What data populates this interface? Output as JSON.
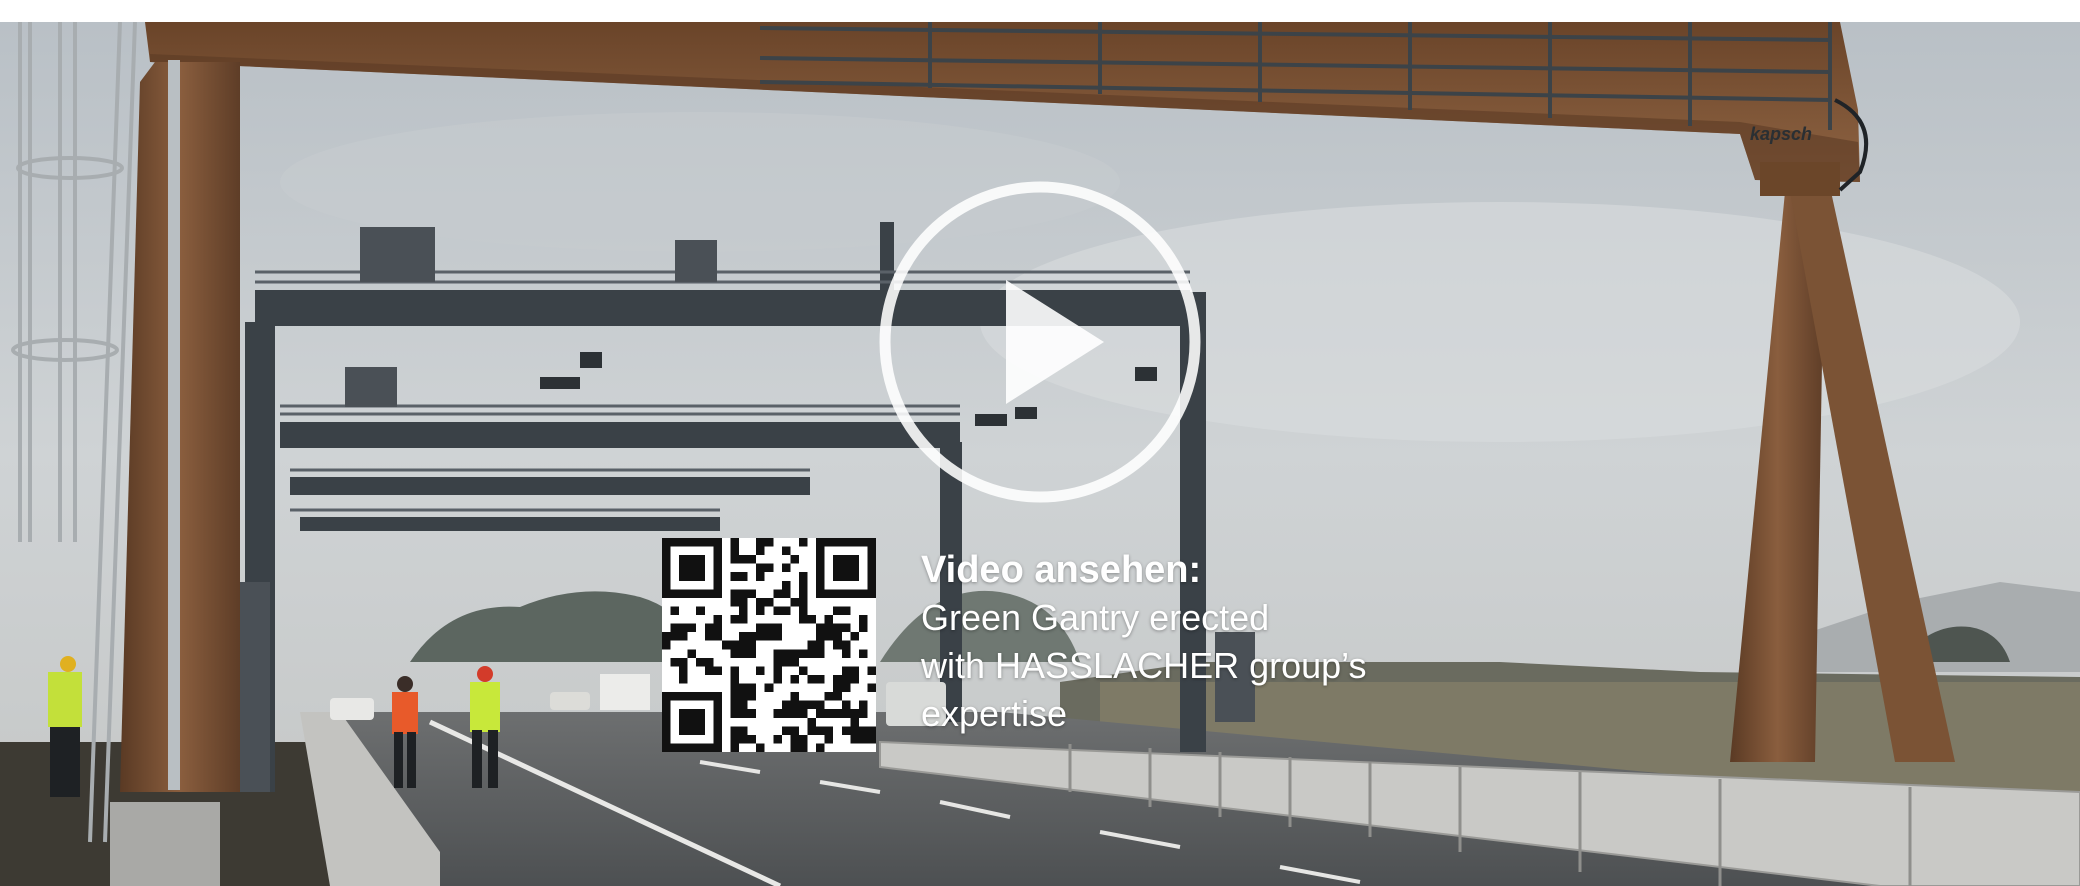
{
  "video": {
    "heading": "Video ansehen:",
    "title_lines": [
      "Green Gantry erected",
      "with HASSLACHER group’s",
      "expertise"
    ],
    "gantry_logo_text": "kapsch"
  },
  "icons": {
    "play": "play-circle-icon",
    "qr": "qr-code-icon"
  },
  "colors": {
    "sky": "#cdd2d6",
    "timber": "#7a5236",
    "steel": "#3a4147",
    "road": "#5c5f61",
    "barrier": "#c9c9c6",
    "overlay_text": "#ffffff"
  }
}
